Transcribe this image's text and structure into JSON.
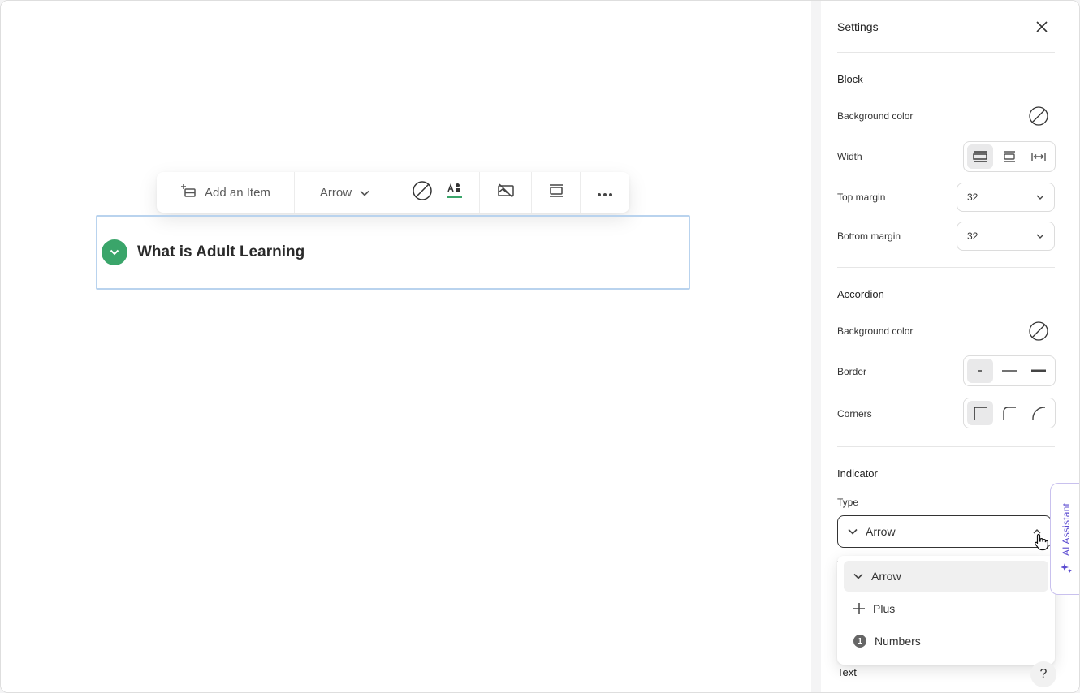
{
  "toolbar": {
    "add_item_label": "Add an Item",
    "indicator_label": "Arrow"
  },
  "accordion": {
    "item_title": "What is Adult Learning",
    "indicator_color": "#3aa56a"
  },
  "settings": {
    "title": "Settings",
    "block": {
      "title": "Block",
      "background_label": "Background color",
      "width_label": "Width",
      "top_margin_label": "Top margin",
      "top_margin_value": "32",
      "bottom_margin_label": "Bottom margin",
      "bottom_margin_value": "32"
    },
    "accordion": {
      "title": "Accordion",
      "background_label": "Background color",
      "border_label": "Border",
      "corners_label": "Corners"
    },
    "indicator": {
      "title": "Indicator",
      "type_label": "Type",
      "type_value": "Arrow",
      "options": [
        "Arrow",
        "Plus",
        "Numbers"
      ],
      "number_badge": "1"
    },
    "text_label": "Text",
    "help_label": "?"
  },
  "ai_assistant": {
    "label": "AI Assistant",
    "color": "#5b4bd0"
  }
}
